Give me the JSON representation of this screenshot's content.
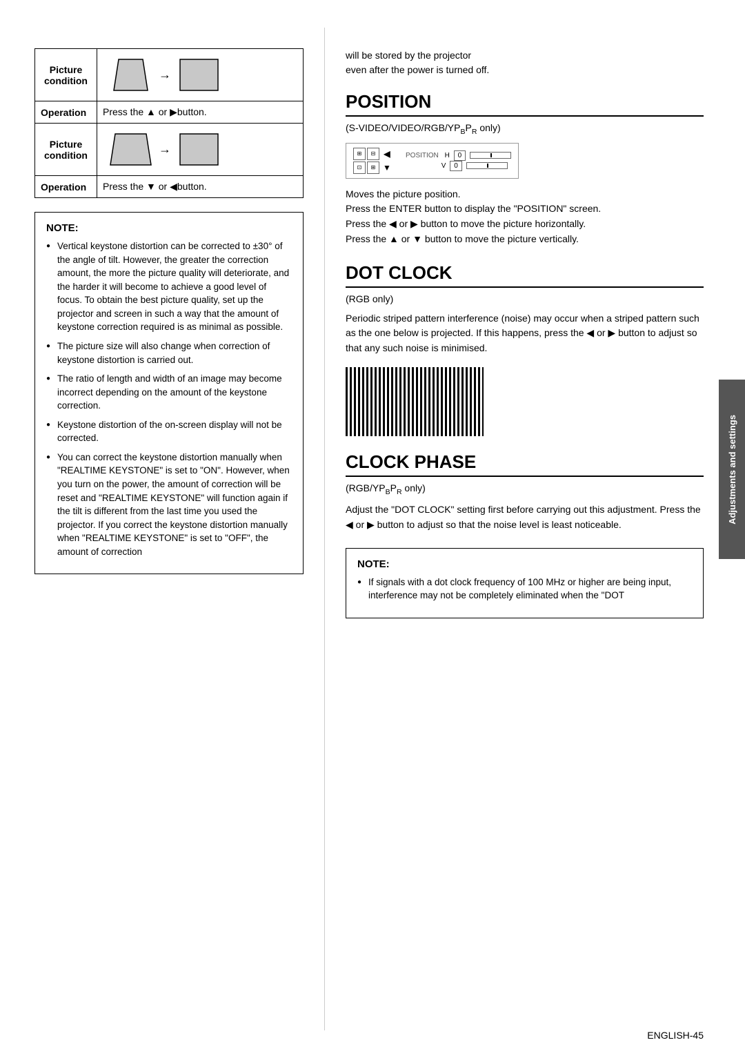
{
  "left": {
    "table": {
      "rows": [
        {
          "type": "picture",
          "label": "Picture\ncondition",
          "diagram": "trapezoid-top"
        },
        {
          "type": "operation",
          "label": "Operation",
          "text": "Press the ▲ or ▶button."
        },
        {
          "type": "picture",
          "label": "Picture\ncondition",
          "diagram": "trapezoid-bottom"
        },
        {
          "type": "operation",
          "label": "Operation",
          "text": "Press the ▼ or ◀button."
        }
      ]
    },
    "note": {
      "title": "NOTE:",
      "items": [
        "Vertical keystone distortion can be corrected to ±30° of the angle of tilt. However, the greater the correction amount, the more the picture quality will deteriorate, and the harder it will become to achieve a good level of focus. To obtain the best picture quality, set up the projector and screen in such a way that the amount of keystone correction required is as minimal as possible.",
        "The picture size will also change when correction of keystone distortion is carried out.",
        "The ratio of length and width of an image may become incorrect depending on the amount of the keystone correction.",
        "Keystone distortion of the on-screen display will not be corrected.",
        "You can correct the keystone distortion manually when \"REALTIME KEYSTONE\" is set to \"ON\". However, when you turn on the power, the amount of correction will be reset and \"REALTIME KEYSTONE\" will function again if the tilt is different from the last time you used the projector. If you correct the keystone distortion manually when \"REALTIME KEYSTONE\" is set to \"OFF\", the amount of correction"
      ]
    }
  },
  "right": {
    "continuation_text": "will be stored by the projector\neven after the power is turned off.",
    "position": {
      "title": "Position",
      "subtitle": "(S-VIDEO/VIDEO/RGB/YPвPР only)",
      "display": {
        "h_label": "H",
        "h_value": "0",
        "v_label": "V",
        "v_value": "0",
        "pos_label": "POSITION"
      },
      "body": [
        "Moves the picture position.",
        "Press the ENTER button to display the \"POSITION\" screen.",
        "Press the ◀ or ▶ button to move the picture horizontally.",
        "Press the ▲ or ▼ button to move the picture vertically."
      ]
    },
    "dot_clock": {
      "title": "Dot Clock",
      "subtitle": "(RGB only)",
      "body": "Periodic striped pattern interference (noise) may occur when a striped pattern such as the one below is projected. If this happens, press the ◀ or ▶ button to adjust so that any such noise is minimised."
    },
    "clock_phase": {
      "title": "Clock Phase",
      "subtitle": "(RGB/YPвPР only)",
      "body": "Adjust the \"DOT CLOCK\" setting first before carrying out this adjustment. Press the ◀ or ▶ button to adjust so that the noise level is least noticeable."
    },
    "note2": {
      "title": "NOTE:",
      "items": [
        "If signals with a dot clock frequency of 100 MHz or higher are being input, interference may not be completely eliminated when the \"DOT"
      ]
    }
  },
  "side_tab": {
    "label": "Adjustments and settings"
  },
  "footer": {
    "text": "English-45",
    "prefix": "E",
    "suffix": "nglish-45"
  }
}
